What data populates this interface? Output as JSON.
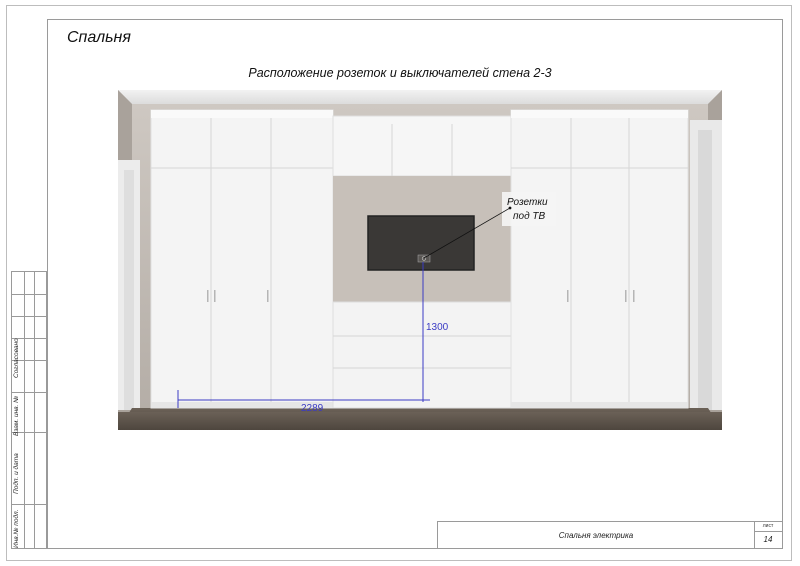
{
  "sheet": {
    "room_title": "Спальня",
    "drawing_title": "Расположение розеток и выключателей стена 2-3"
  },
  "annotations": {
    "outlet_label_line1": "Розетки",
    "outlet_label_line2": "под ТВ",
    "dim_height": "1300",
    "dim_width": "2289"
  },
  "side_stamp": {
    "agreed": "Согласовано",
    "replaced_inv": "Взам. инв. №",
    "sign_date": "Подп. и дата",
    "inv_original": "Инв.№ подл."
  },
  "title_block": {
    "name": "Спальня электрика",
    "sheet_label": "лист",
    "sheet_number": "14"
  },
  "colors": {
    "wall": "#b9b1aa",
    "cabinet": "#f4f4f4",
    "floor": "#5e544a",
    "tv": "#3a3836",
    "dimension": "#3b3bc4"
  }
}
